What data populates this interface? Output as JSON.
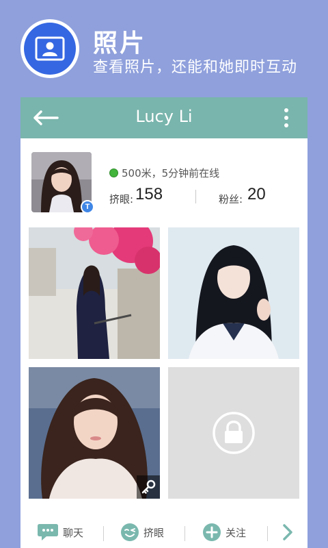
{
  "promo": {
    "title": "照片",
    "subtitle": "查看照片，还能和她即时互动",
    "badge_icon": "profile-card-icon"
  },
  "topbar": {
    "title": "Lucy Li",
    "back_icon": "arrow-left-icon",
    "more_icon": "more-vertical-icon",
    "color": "#79b5ac"
  },
  "profile": {
    "status": "500米，5分钟前在线",
    "badge_letter": "T",
    "wink_label": "挤眼:",
    "wink_count": "158",
    "fans_label": "粉丝:",
    "fans_count": "20"
  },
  "photos": [
    {
      "kind": "photo",
      "locked": false
    },
    {
      "kind": "photo",
      "locked": false
    },
    {
      "kind": "photo",
      "locked": false,
      "key_icon": true
    },
    {
      "kind": "placeholder",
      "locked": true
    }
  ],
  "actions": {
    "chat": "聊天",
    "wink": "挤眼",
    "follow": "关注"
  },
  "colors": {
    "background": "#8fa0dc",
    "accent": "#3567e2",
    "icon": "#7ab8ae"
  }
}
